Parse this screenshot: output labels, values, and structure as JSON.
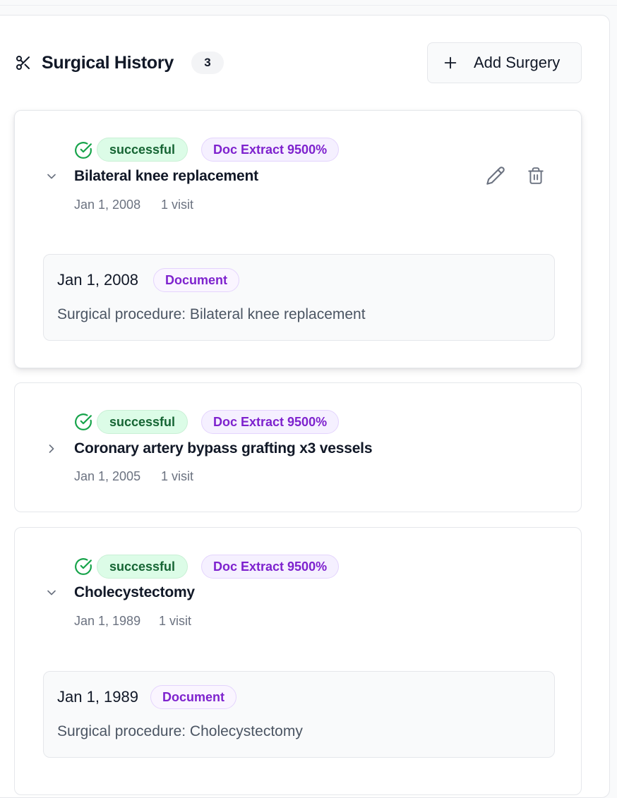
{
  "header": {
    "title": "Surgical History",
    "count": "3",
    "add_button_label": "Add Surgery"
  },
  "surgeries": [
    {
      "status": "successful",
      "source": "Doc Extract 9500%",
      "name": "Bilateral knee replacement",
      "date": "Jan 1, 2008",
      "visits": "1 visit",
      "expanded": true,
      "visit": {
        "date": "Jan 1, 2008",
        "type": "Document",
        "description": "Surgical procedure: Bilateral knee replacement"
      }
    },
    {
      "status": "successful",
      "source": "Doc Extract 9500%",
      "name": "Coronary artery bypass grafting x3 vessels",
      "date": "Jan 1, 2005",
      "visits": "1 visit",
      "expanded": false
    },
    {
      "status": "successful",
      "source": "Doc Extract 9500%",
      "name": "Cholecystectomy",
      "date": "Jan 1, 1989",
      "visits": "1 visit",
      "expanded": true,
      "visit": {
        "date": "Jan 1, 1989",
        "type": "Document",
        "description": "Surgical procedure: Cholecystectomy"
      }
    }
  ],
  "colors": {
    "success_bg": "#dcfce7",
    "success_text": "#166534",
    "success_icon": "#16a34a",
    "doc_badge_bg": "#f5f0ff",
    "doc_badge_text": "#7e22ce"
  },
  "icons": {
    "header": "scissors-icon",
    "add": "plus-icon",
    "status": "check-circle-icon",
    "expanded": "chevron-down-icon",
    "collapsed": "chevron-right-icon",
    "edit": "pencil-icon",
    "delete": "trash-icon"
  }
}
